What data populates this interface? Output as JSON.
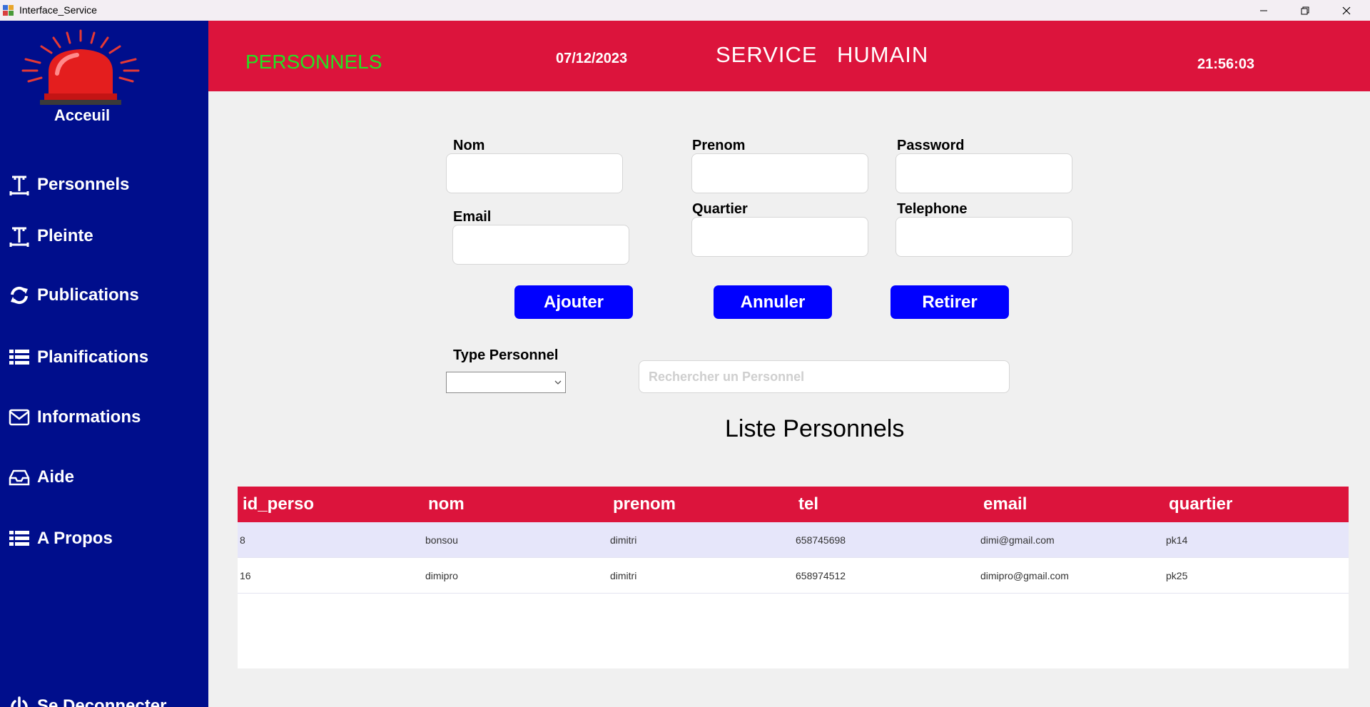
{
  "window": {
    "title": "Interface_Service",
    "controls": {
      "minimize": "minimize-icon",
      "restore": "restore-icon",
      "close": "close-icon"
    }
  },
  "sidebar": {
    "home_label": "Acceuil",
    "items": [
      {
        "label": "Personnels",
        "icon": "text-cursor-icon"
      },
      {
        "label": "Pleinte",
        "icon": "text-cursor-icon"
      },
      {
        "label": "Publications",
        "icon": "refresh-icon"
      },
      {
        "label": "Planifications",
        "icon": "list-icon"
      },
      {
        "label": "Informations",
        "icon": "envelope-icon"
      },
      {
        "label": "Aide",
        "icon": "inbox-icon"
      },
      {
        "label": "A Propos",
        "icon": "list-icon"
      }
    ],
    "logout_label": "Se Deconnecter"
  },
  "header": {
    "section": "PERSONNELS",
    "date": "07/12/2023",
    "service_word1": "SERVICE",
    "service_word2": "HUMAIN",
    "time": "21:56:03"
  },
  "form": {
    "labels": {
      "nom": "Nom",
      "prenom": "Prenom",
      "password": "Password",
      "email": "Email",
      "quartier": "Quartier",
      "telephone": "Telephone",
      "type_personnel": "Type Personnel"
    },
    "values": {
      "nom": "",
      "prenom": "",
      "password": "",
      "email": "",
      "quartier": "",
      "telephone": "",
      "type_personnel": ""
    },
    "buttons": {
      "add": "Ajouter",
      "cancel": "Annuler",
      "remove": "Retirer"
    },
    "search_placeholder": "Rechercher un Personnel"
  },
  "list": {
    "title": "Liste Personnels",
    "columns": [
      "id_perso",
      "nom",
      "prenom",
      "tel",
      "email",
      "quartier"
    ],
    "rows": [
      [
        "8",
        "bonsou",
        "dimitri",
        "658745698",
        "dimi@gmail.com",
        "pk14"
      ],
      [
        "16",
        "dimipro",
        "dimitri",
        "658974512",
        "dimipro@gmail.com",
        "pk25"
      ]
    ]
  },
  "colors": {
    "sidebar": "#000e8c",
    "header": "#dc143c",
    "section_title": "#22e322",
    "button": "#0000ff",
    "selected_row": "#e6e6fa"
  }
}
